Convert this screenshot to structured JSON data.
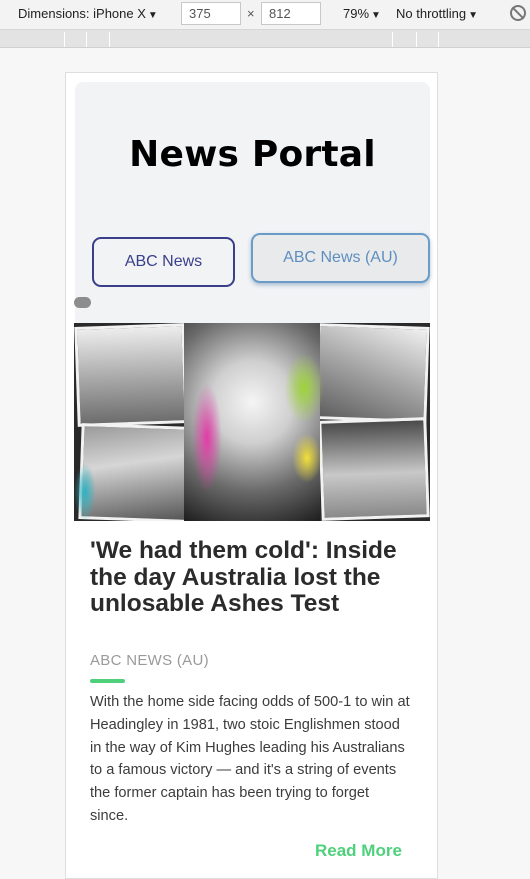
{
  "devtools": {
    "dimensions_label": "Dimensions: iPhone X",
    "width_value": "375",
    "times": "×",
    "height_value": "812",
    "zoom": "79%",
    "throttling": "No throttling",
    "caret": "▼",
    "rotate_icon": "rotate-icon"
  },
  "page": {
    "title": "News Portal",
    "sources": [
      {
        "label": "ABC News",
        "active": false
      },
      {
        "label": "ABC News (AU)",
        "active": true
      }
    ]
  },
  "article": {
    "headline": "'We had them cold': Inside the day Australia lost the unlosable Ashes Test",
    "source": "ABC NEWS (AU)",
    "summary": "With the home side facing odds of 500-1 to win at Headingley in 1981, two stoic Englishmen stood in the way of Kim Hughes leading his Australians to a famous victory — and it's a string of events the former captain has been trying to forget since.",
    "read_more": "Read More"
  },
  "colors": {
    "accent_green": "#4fd17c",
    "button_navy": "#3b3f8a",
    "button_blue": "#6b9cc7"
  }
}
